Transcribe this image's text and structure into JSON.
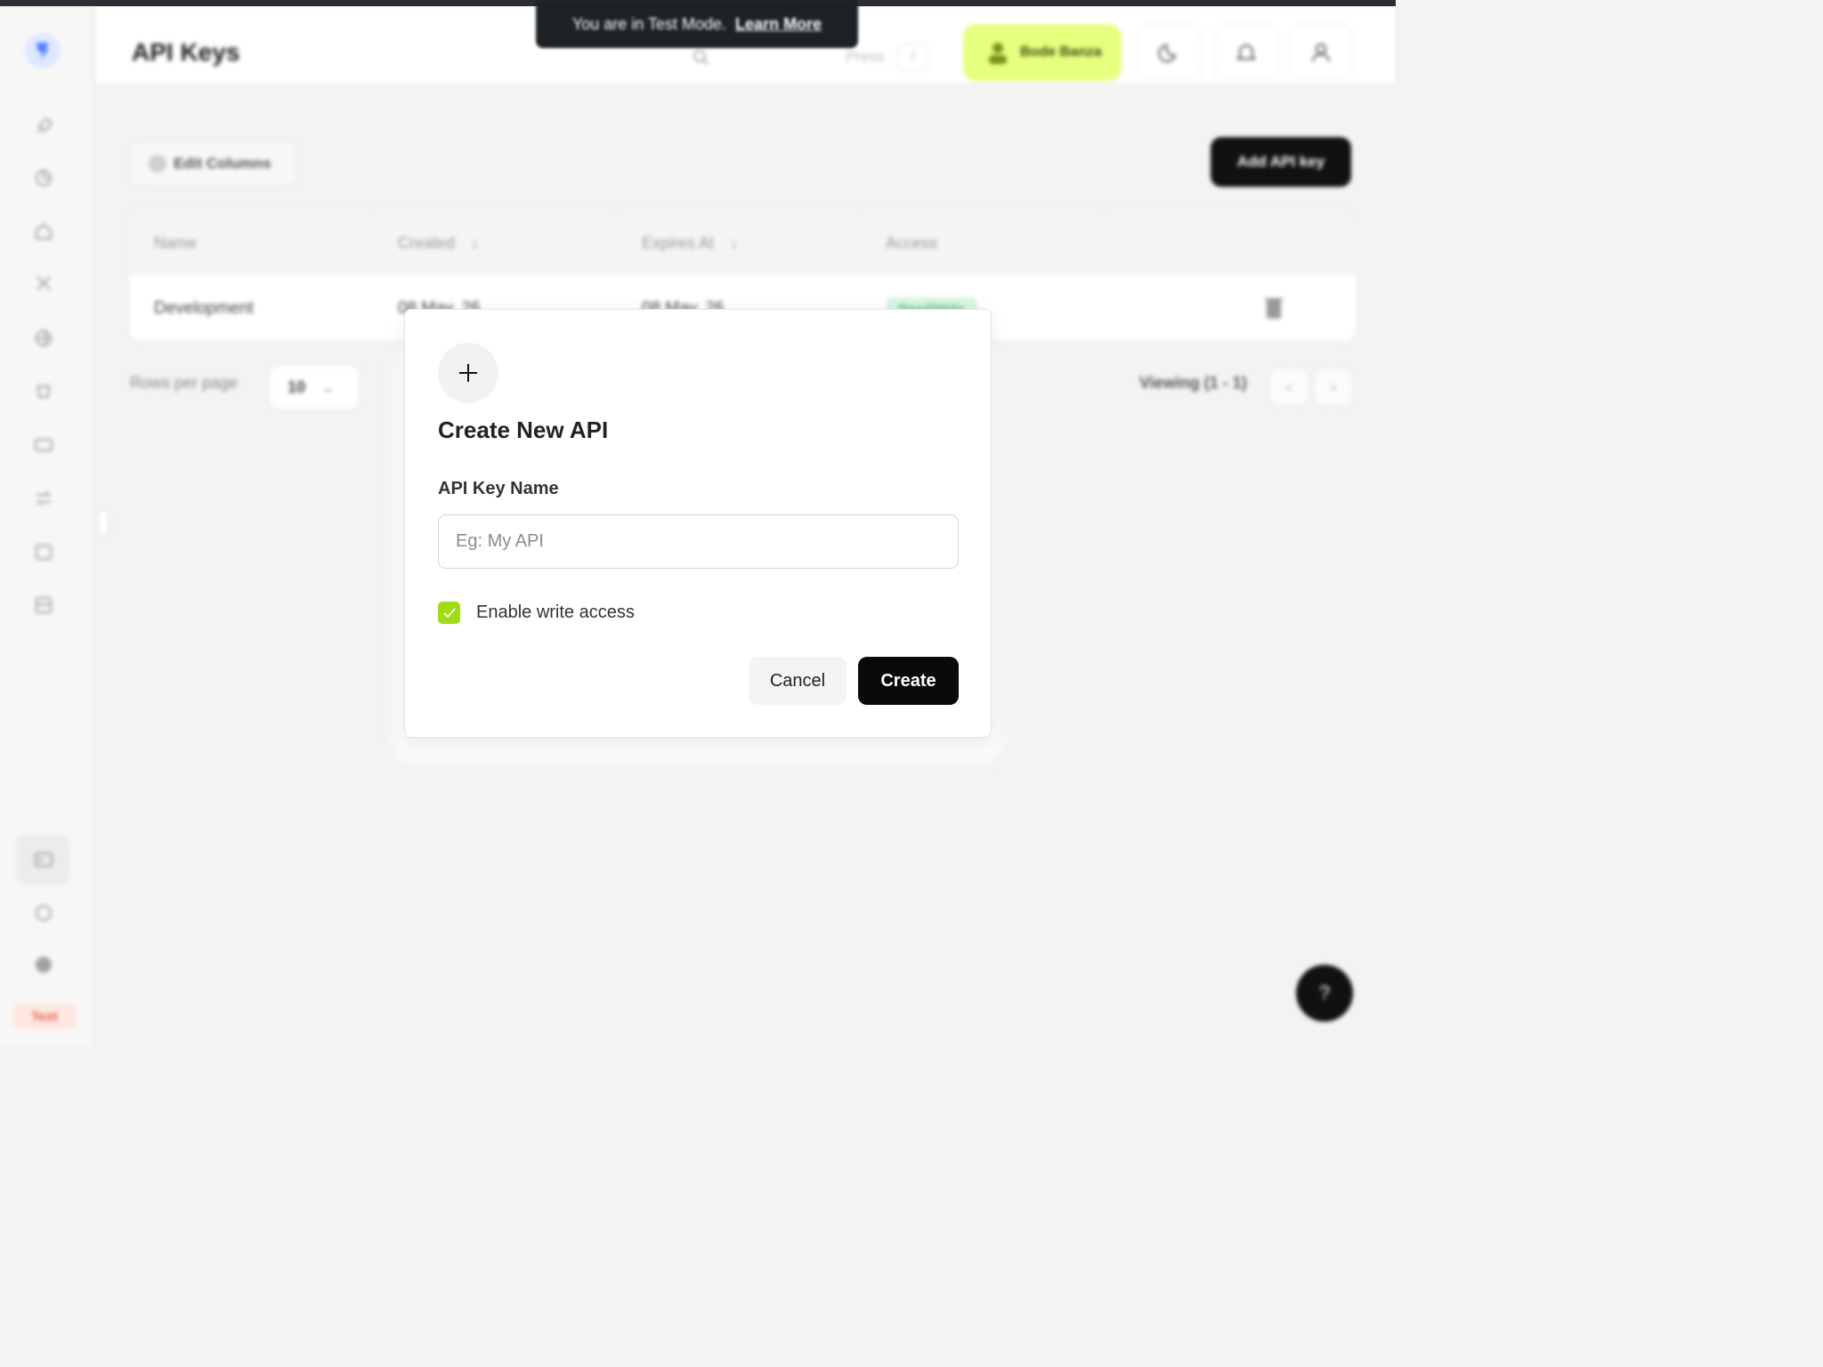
{
  "banner": {
    "text": "You are in Test Mode.",
    "link": "Learn More"
  },
  "header": {
    "title": "API Keys",
    "search_hint": "Press",
    "search_shortcut": "/",
    "user_name": "Bode Banza"
  },
  "toolbar": {
    "edit_columns": "Edit Columns",
    "add_key": "Add API key"
  },
  "table": {
    "columns": [
      "Name",
      "Created",
      "Expires At",
      "Access"
    ],
    "rows": [
      {
        "name": "Development",
        "created": "08 May, 26",
        "expires": "08 May, 26",
        "access": "Read/Write"
      }
    ]
  },
  "pagination": {
    "rows_label": "Rows per page",
    "rows_value": "10",
    "viewing": "Viewing (1 - 1)"
  },
  "sidebar": {
    "test_badge": "Test"
  },
  "help": {
    "label": "?"
  },
  "modal": {
    "title": "Create New API",
    "field_label": "API Key Name",
    "field_placeholder": "Eg: My API",
    "field_value": "",
    "checkbox_label": "Enable write access",
    "checkbox_checked": true,
    "cancel": "Cancel",
    "create": "Create"
  },
  "colors": {
    "accent": "#a0db14",
    "user_pill": "#e6ff7e",
    "primary_button": "#0a0a0a",
    "badge_bg": "#d6f5e0"
  }
}
